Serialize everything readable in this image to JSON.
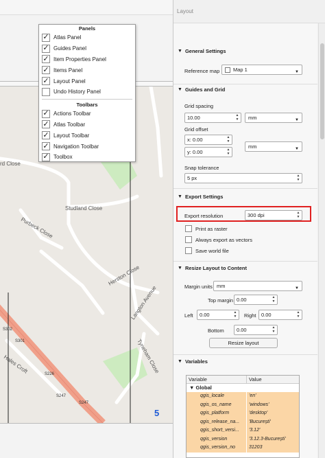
{
  "panel": {
    "title": "Layout"
  },
  "menu": {
    "panels_header": "Panels",
    "panels": [
      {
        "label": "Atlas Panel",
        "checked": true
      },
      {
        "label": "Guides Panel",
        "checked": true
      },
      {
        "label": "Item Properties Panel",
        "checked": true
      },
      {
        "label": "Items Panel",
        "checked": true
      },
      {
        "label": "Layout Panel",
        "checked": true
      },
      {
        "label": "Undo History Panel",
        "checked": false
      }
    ],
    "toolbars_header": "Toolbars",
    "toolbars": [
      {
        "label": "Actions Toolbar",
        "checked": true
      },
      {
        "label": "Atlas Toolbar",
        "checked": true
      },
      {
        "label": "Layout Toolbar",
        "checked": true
      },
      {
        "label": "Navigation Toolbar",
        "checked": true
      },
      {
        "label": "Toolbox",
        "checked": true
      }
    ]
  },
  "map": {
    "streets": [
      "Studland Close",
      "Purbeck Close",
      "Herston Close",
      "Langton Avenue",
      "Tyneham Close",
      "Hales Croft",
      "rd Close"
    ],
    "page_number": "5",
    "codes": [
      "S302",
      "S301",
      "S226",
      "S247",
      "S247"
    ]
  },
  "general": {
    "title": "General Settings",
    "reference_map_label": "Reference map",
    "reference_map_value": "Map 1"
  },
  "guides": {
    "title": "Guides and Grid",
    "grid_spacing_label": "Grid spacing",
    "grid_spacing_value": "10.00",
    "grid_spacing_unit": "mm",
    "grid_offset_label": "Grid offset",
    "offset_x": "x: 0.00",
    "offset_y": "y: 0.00",
    "offset_unit": "mm",
    "snap_label": "Snap tolerance",
    "snap_value": "5 px"
  },
  "export": {
    "title": "Export Settings",
    "resolution_label": "Export resolution",
    "resolution_value": "300 dpi",
    "print_raster": "Print as raster",
    "always_vectors": "Always export as vectors",
    "save_world": "Save world file"
  },
  "resize": {
    "title": "Resize Layout to Content",
    "margin_units_label": "Margin units",
    "margin_units_value": "mm",
    "top_label": "Top margin",
    "top_value": "0.00",
    "left_label": "Left",
    "left_value": "0.00",
    "right_label": "Right",
    "right_value": "0.00",
    "bottom_label": "Bottom",
    "bottom_value": "0.00",
    "button": "Resize layout"
  },
  "variables": {
    "title": "Variables",
    "col_variable": "Variable",
    "col_value": "Value",
    "group": "Global",
    "rows": [
      {
        "k": "qgis_locale",
        "v": "'en'"
      },
      {
        "k": "qgis_os_name",
        "v": "'windows'"
      },
      {
        "k": "qgis_platform",
        "v": "'desktop'"
      },
      {
        "k": "qgis_release_na...",
        "v": "'București'"
      },
      {
        "k": "qgis_short_versi...",
        "v": "'3.12'"
      },
      {
        "k": "qgis_version",
        "v": "'3.12.3-București'"
      },
      {
        "k": "qgis_version_no",
        "v": "31203"
      }
    ]
  }
}
